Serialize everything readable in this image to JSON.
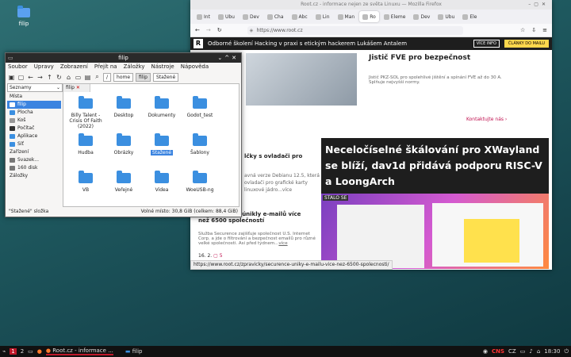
{
  "desktop": {
    "icon_label": "filip"
  },
  "firefox": {
    "window_title": "Root.cz - informace nejen ze světa Linuxu — Mozilla Firefox",
    "tabs": [
      {
        "label": "Int"
      },
      {
        "label": "Ubu"
      },
      {
        "label": "Dev"
      },
      {
        "label": "Cha"
      },
      {
        "label": "Abc"
      },
      {
        "label": "Lin"
      },
      {
        "label": "Man"
      },
      {
        "label": "Ro"
      },
      {
        "label": "Eleme"
      },
      {
        "label": "Dev"
      },
      {
        "label": "Ubu"
      },
      {
        "label": "Ele"
      }
    ],
    "url": "https://www.root.cz",
    "banner_text": "Odborné školení Hacking v praxi s etickým hackerem Lukášem Antalem",
    "btn_info": "VÍCE INFO",
    "btn_mail": "ČLÁNKY DO MAILU",
    "ad_title": "Jistič FVE pro bezpečnost",
    "ad_text": "Jistič PKZ-SOL pro spolehlivé jištění a spínání FVE až do 30 A. Splňuje nejvyšší normy.",
    "contact_link": "Kontaktujte nás",
    "left_article_title": "lčky s ovladači pro",
    "left_article_lines": [
      "avná verze Debianu 12.5, která",
      "ovladači pro grafické karty",
      "linuxové jádro...více"
    ],
    "main_article_title": "Neceločíselné škálování pro XWayland se blíží, dav1d přidává podporu RISC-V a LoongArch",
    "screenshot_label": "STALO SE",
    "second_title": "Bezpečnostní únikly e-mailů více než 6500 společností",
    "second_text": "Služba Securence zajišťuje společnost U.S. Internet Corp. a jde o filtrování a bezpečnost emailů pro různé velké společnosti. Asi před týdnem...",
    "second_more": "více",
    "second_date": "16. 2.",
    "second_comments": "5",
    "status_url": "https://www.root.cz/zpravicky/securence-uniky-e-mailu-vice-nez-6500-spolecnosti/"
  },
  "thunar": {
    "window_title": "filip",
    "menu": [
      "Soubor",
      "Upravy",
      "Zobrazení",
      "Přejít na",
      "Záložky",
      "Nástroje",
      "Nápověda"
    ],
    "crumbs": [
      "home",
      "filip",
      "Stažené"
    ],
    "places_select": "Seznamy",
    "tab_label": "filip",
    "sections": {
      "places": "Místa",
      "devices": "Zařízení",
      "bookmarks": "Záložky"
    },
    "places": [
      "filip",
      "Plocha",
      "Koš",
      "Počítač",
      "Aplikace",
      "Síť"
    ],
    "devices": [
      "Svazek...",
      "160 disk"
    ],
    "items": [
      "Billy Talent - Crisis Of Faith (2022)",
      "Desktop",
      "Dokumenty",
      "Godot_test",
      "Hudba",
      "Obrázky",
      "Stažené",
      "Šablony",
      "VB",
      "Veřejné",
      "Videa",
      "WoeUSB-ng"
    ],
    "status_left": "\"Stažené\" složka",
    "status_right": "Volné místo: 30,8 GiB (celkem: 88,4 GiB)"
  },
  "taskbar": {
    "workspaces": [
      "1",
      "2"
    ],
    "task_firefox": "Root.cz - informace ...",
    "task_files": "filip",
    "lang": "CZ",
    "clock": "18:30"
  },
  "colors": {
    "accent": "#3b84e0",
    "folder": "#3b8fe0",
    "banner": "#1e1e1e",
    "mail_btn": "#ffd84d"
  }
}
